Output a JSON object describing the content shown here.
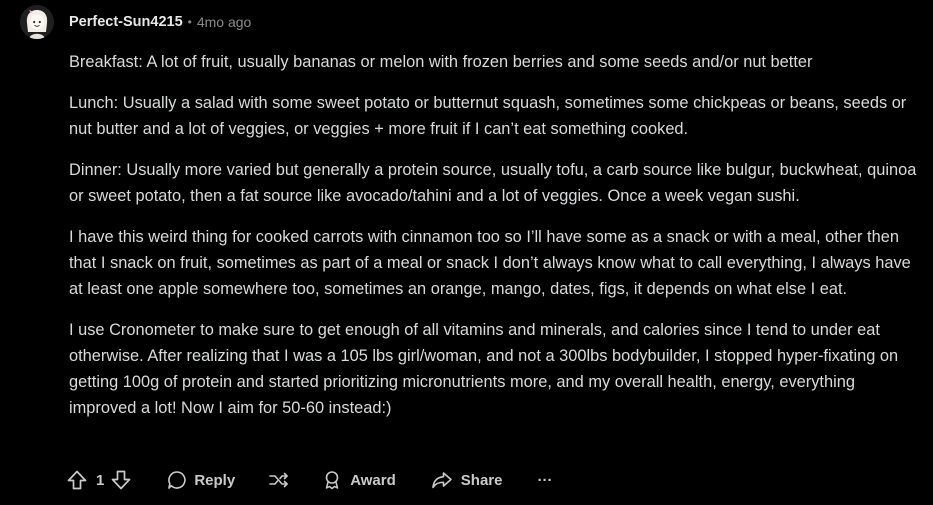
{
  "comment": {
    "author": "Perfect-Sun4215",
    "separator": "•",
    "age": "4mo ago",
    "paragraphs": [
      "Breakfast: A lot of fruit, usually bananas or melon with frozen berries and some seeds and/or nut better",
      "Lunch: Usually a salad with some sweet potato or butternut squash, sometimes some chickpeas or beans, seeds or nut butter and a lot of veggies, or veggies + more fruit if I can’t eat something cooked.",
      "Dinner: Usually more varied but generally a protein source, usually tofu, a carb source like bulgur, buckwheat, quinoa or sweet potato, then a fat source like avocado/tahini and a lot of veggies. Once a week vegan sushi.",
      "I have this weird thing for cooked carrots with cinnamon too so I’ll have some as a snack or with a meal, other then that I snack on fruit, sometimes as part of a meal or snack I don’t always know what to call everything, I always have at least one apple somewhere too, sometimes an orange, mango, dates, figs, it depends on what else I eat.",
      "I use Cronometer to make sure to get enough of all vitamins and minerals, and calories since I tend to under eat otherwise. After realizing that I was a 105 lbs girl/woman, and not a 300lbs bodybuilder, I stopped hyper-fixating on getting 100g of protein and started prioritizing micronutrients more, and my overall health, energy, everything improved a lot! Now I aim for 50-60 instead:)"
    ]
  },
  "actions": {
    "vote_count": "1",
    "reply_label": "Reply",
    "award_label": "Award",
    "share_label": "Share",
    "more_label": "···"
  },
  "icons": {
    "avatar": "avatar-icon",
    "upvote": "upvote-arrow-icon",
    "downvote": "downvote-arrow-icon",
    "reply": "speech-bubble-icon",
    "crosspost": "crosspost-icon",
    "award": "award-icon",
    "share": "share-arrow-icon"
  },
  "colors": {
    "background": "#000000",
    "text": "#d8dadc",
    "muted": "#8a8a8a",
    "username": "#e8e8e8"
  }
}
